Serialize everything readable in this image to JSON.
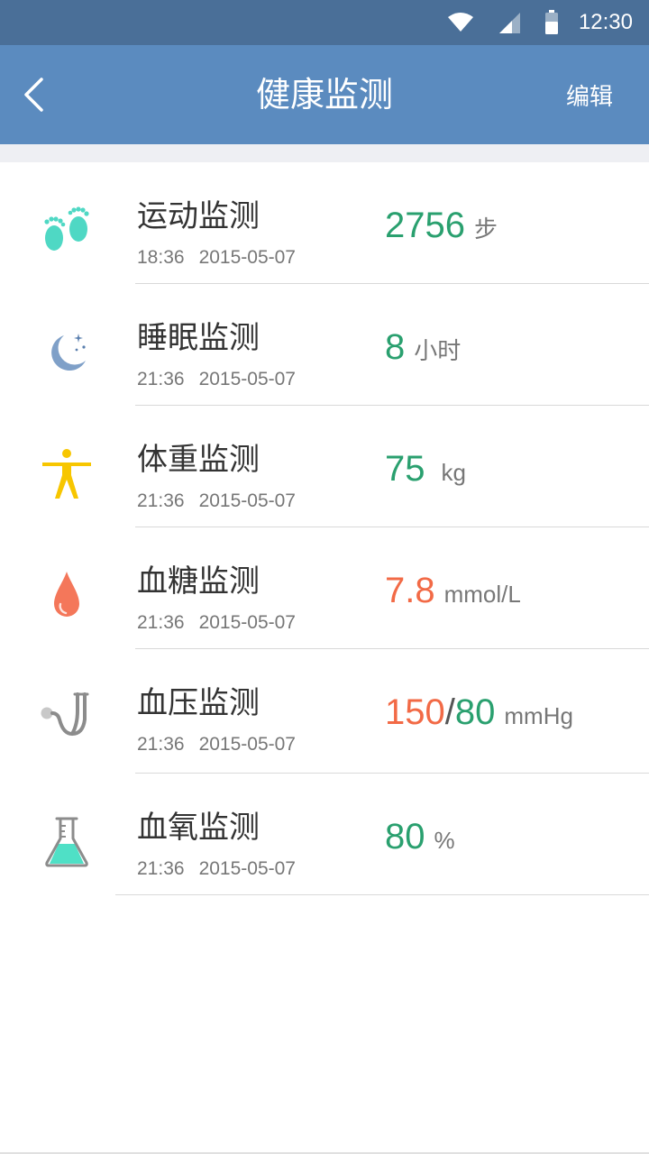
{
  "status_bar": {
    "time": "12:30"
  },
  "header": {
    "title": "健康监测",
    "edit_label": "编辑"
  },
  "items": [
    {
      "name": "运动监测",
      "time": "18:36",
      "date": "2015-05-07",
      "value": "2756",
      "unit": "步",
      "icon": "footprints-icon"
    },
    {
      "name": "睡眠监测",
      "time": "21:36",
      "date": "2015-05-07",
      "value": "8",
      "unit": "小时",
      "icon": "moon-stars-icon"
    },
    {
      "name": "体重监测",
      "time": "21:36",
      "date": "2015-05-07",
      "value": "75",
      "unit": "kg",
      "icon": "person-icon"
    },
    {
      "name": "血糖监测",
      "time": "21:36",
      "date": "2015-05-07",
      "value": "7.8",
      "unit": "mmol/L",
      "icon": "blood-drop-icon"
    },
    {
      "name": "血压监测",
      "time": "21:36",
      "date": "2015-05-07",
      "value_high": "150",
      "value_low": "80",
      "separator": "/",
      "unit": "mmHg",
      "icon": "stethoscope-icon"
    },
    {
      "name": "血氧监测",
      "time": "21:36",
      "date": "2015-05-07",
      "value": "80",
      "unit": "%",
      "icon": "flask-icon"
    }
  ],
  "colors": {
    "status_bar": "#4a6f98",
    "app_bar": "#5b8bbf",
    "value_green": "#2aa06f",
    "value_orange": "#f26a46"
  }
}
